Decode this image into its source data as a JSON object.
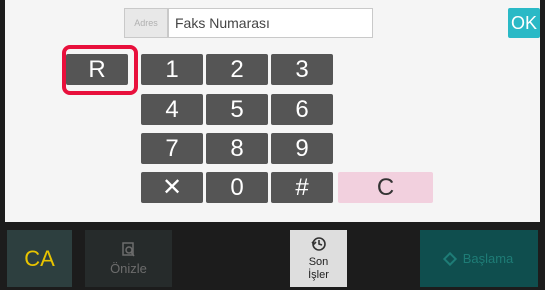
{
  "header": {
    "address_button_label": "Adres",
    "fax_number_placeholder": "Faks Numarası",
    "ok_label": "OK"
  },
  "keypad": {
    "keys": [
      "R",
      "1",
      "2",
      "3",
      "4",
      "5",
      "6",
      "7",
      "8",
      "9",
      "✕",
      "0",
      "#",
      "C"
    ]
  },
  "footer": {
    "ca_label": "CA",
    "preview_label": "Önizle",
    "recent_jobs_label_line1": "Son",
    "recent_jobs_label_line2": "İşler",
    "start_label": "Başlama"
  },
  "colors": {
    "accent": "#2ab9c6",
    "highlight": "#e8103c",
    "key": "#555555",
    "clear": "#f2d0de",
    "ca_text": "#e8c400"
  }
}
